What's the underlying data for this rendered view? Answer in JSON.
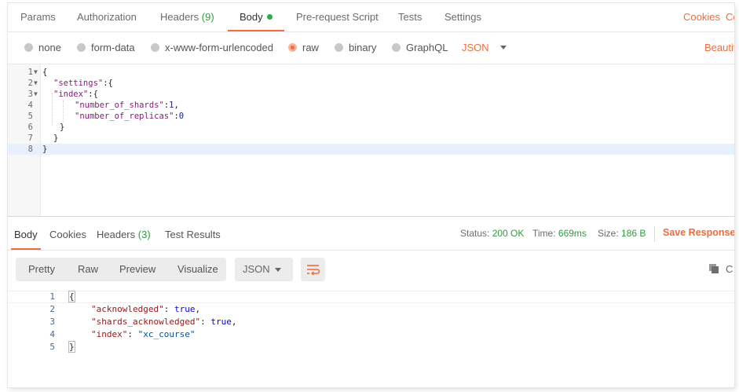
{
  "request_tabs": {
    "params": "Params",
    "authorization": "Authorization",
    "headers_label": "Headers",
    "headers_count": "(9)",
    "body": "Body",
    "prerequest": "Pre-request Script",
    "tests": "Tests",
    "settings": "Settings",
    "cookies": "Cookies",
    "code": "Co"
  },
  "body_types": {
    "none": "none",
    "form_data": "form-data",
    "urlencoded": "x-www-form-urlencoded",
    "raw": "raw",
    "binary": "binary",
    "graphql": "GraphQL",
    "language": "JSON",
    "beautify": "Beautif"
  },
  "request_editor": {
    "line_numbers": [
      "1",
      "2",
      "3",
      "4",
      "5",
      "6",
      "7",
      "8"
    ],
    "l1": "{",
    "l2_key": "\"settings\"",
    "l2_rest": ":{",
    "l3_key": "\"index\"",
    "l3_rest": ":{",
    "l4_key": "\"number_of_shards\"",
    "l4_colon": ":",
    "l4_val": "1",
    "l4_comma": ",",
    "l5_key": "\"number_of_replicas\"",
    "l5_colon": ":",
    "l5_val": "0",
    "l6": "}",
    "l7": "}",
    "l8": "}"
  },
  "response_tabs": {
    "body": "Body",
    "cookies": "Cookies",
    "headers_label": "Headers",
    "headers_count": "(3)",
    "test_results": "Test Results"
  },
  "response_meta": {
    "status_label": "Status:",
    "status_value": "200 OK",
    "time_label": "Time:",
    "time_value": "669ms",
    "size_label": "Size:",
    "size_value": "186 B",
    "save_response": "Save Response"
  },
  "view_modes": {
    "pretty": "Pretty",
    "raw": "Raw",
    "preview": "Preview",
    "visualize": "Visualize",
    "format": "JSON",
    "search_fragment": "C"
  },
  "response_body": {
    "line_numbers": [
      "1",
      "2",
      "3",
      "4",
      "5"
    ],
    "l1": "{",
    "l2_key": "\"acknowledged\"",
    "l2_sep": ": ",
    "l2_val": "true",
    "l2_comma": ",",
    "l3_key": "\"shards_acknowledged\"",
    "l3_sep": ": ",
    "l3_val": "true",
    "l3_comma": ",",
    "l4_key": "\"index\"",
    "l4_sep": ": ",
    "l4_val": "\"xc_course\"",
    "l5": "}"
  },
  "colors": {
    "accent": "#f26b3a",
    "success": "#2f9c3d",
    "active_dot": "#2fa84f"
  },
  "icons": [
    "fold-arrow-icon",
    "caret-down-icon",
    "wrap-lines-icon",
    "copy-icon"
  ]
}
